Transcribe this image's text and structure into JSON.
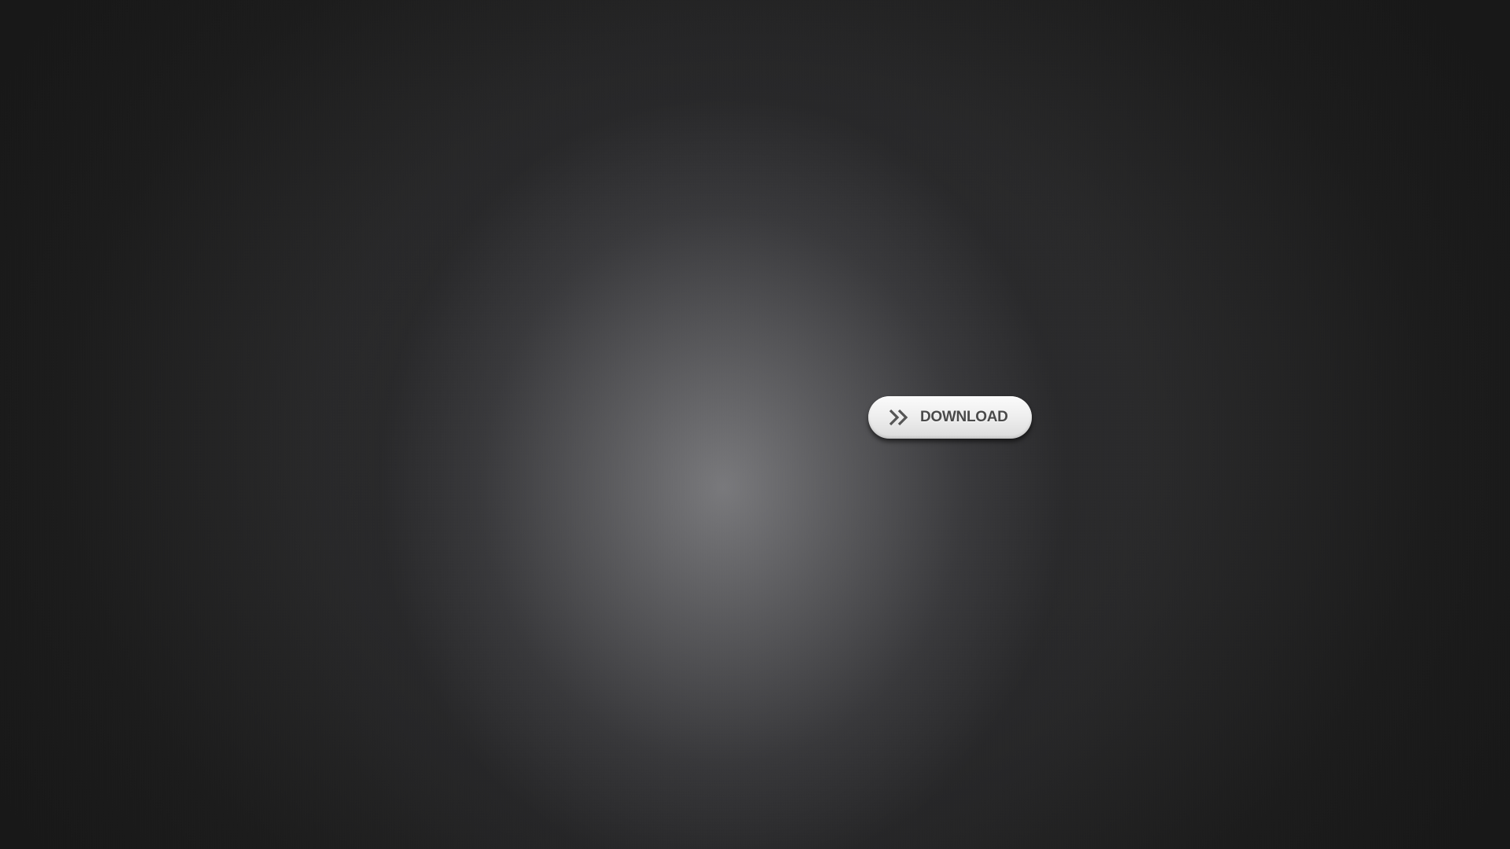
{
  "background": {
    "colors": {
      "center": "#7d7d80",
      "edge": "#171717"
    }
  },
  "download_button": {
    "label": "DOWNLOAD",
    "icon": "double-chevron-right-icon",
    "text_color": "#4a4a4a",
    "face_color": "#efefef"
  }
}
